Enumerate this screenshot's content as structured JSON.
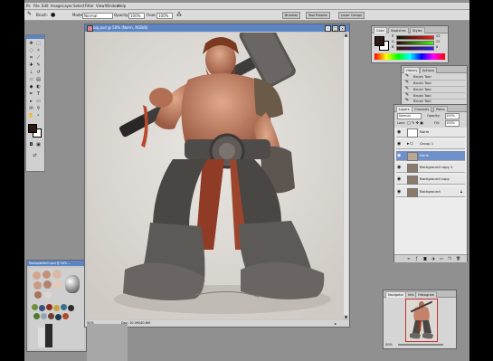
{
  "app": {
    "name": "Photoshop"
  },
  "menu": [
    "File",
    "Edit",
    "Image",
    "Layer",
    "Select",
    "Filter",
    "View",
    "Window",
    "Help"
  ],
  "options_bar": {
    "brush_label": "Brush:",
    "mode_label": "Mode:",
    "mode_value": "Normal",
    "opacity_label": "Opacity:",
    "opacity_value": "100%",
    "flow_label": "Flow:",
    "flow_value": "100%"
  },
  "well_tabs": [
    "Brushes",
    "Tool Presets",
    "Layer Comps"
  ],
  "document": {
    "title": "big psd @ 50% (Norm, RGB/8)",
    "zoom": "50%",
    "doc_info": "Doc: 10.0M/40.6M"
  },
  "color_panel": {
    "tabs": [
      "Color",
      "Swatches",
      "Styles"
    ],
    "channels": [
      {
        "label": "R",
        "value": "53"
      },
      {
        "label": "G",
        "value": "22"
      },
      {
        "label": "B",
        "value": "8"
      }
    ],
    "fg_color": "#2a1a12",
    "bg_color": "#ffffff"
  },
  "history_panel": {
    "tabs": [
      "History",
      "Actions"
    ],
    "items": [
      "Brush Tool",
      "Brush Tool",
      "Brush Tool",
      "Brush Tool",
      "Brush Tool"
    ]
  },
  "layers_panel": {
    "tabs": [
      "Layers",
      "Channels",
      "Paths"
    ],
    "blend_mode": "Normal",
    "opacity_label": "Opacity:",
    "opacity_value": "100%",
    "lock_label": "Lock:",
    "fill_label": "Fill:",
    "fill_value": "100%",
    "layers": [
      {
        "name": "Norm",
        "type": "layer",
        "selected": false,
        "thumb": "#ffffff"
      },
      {
        "name": "Group 1",
        "type": "group",
        "selected": false,
        "thumb": "#d8d8d8"
      },
      {
        "name": "Norm",
        "type": "layer",
        "selected": true,
        "thumb": "#b8a898"
      },
      {
        "name": "Background copy 2",
        "type": "layer",
        "selected": false,
        "thumb": "#8c7a6a"
      },
      {
        "name": "Background copy",
        "type": "layer",
        "selected": false,
        "thumb": "#8c7a6a"
      },
      {
        "name": "Background",
        "type": "layer",
        "selected": false,
        "thumb": "#8c7a6a"
      }
    ]
  },
  "navigator_panel": {
    "tabs": [
      "Navigator",
      "Info",
      "Histogram"
    ],
    "zoom": "50%"
  },
  "palette_doc": {
    "title": "flashpalette01.psd @ 50% ..."
  },
  "icons": {
    "eye": "eye-icon",
    "folder": "folder-icon",
    "brush": "brush-icon",
    "close": "close-icon"
  }
}
